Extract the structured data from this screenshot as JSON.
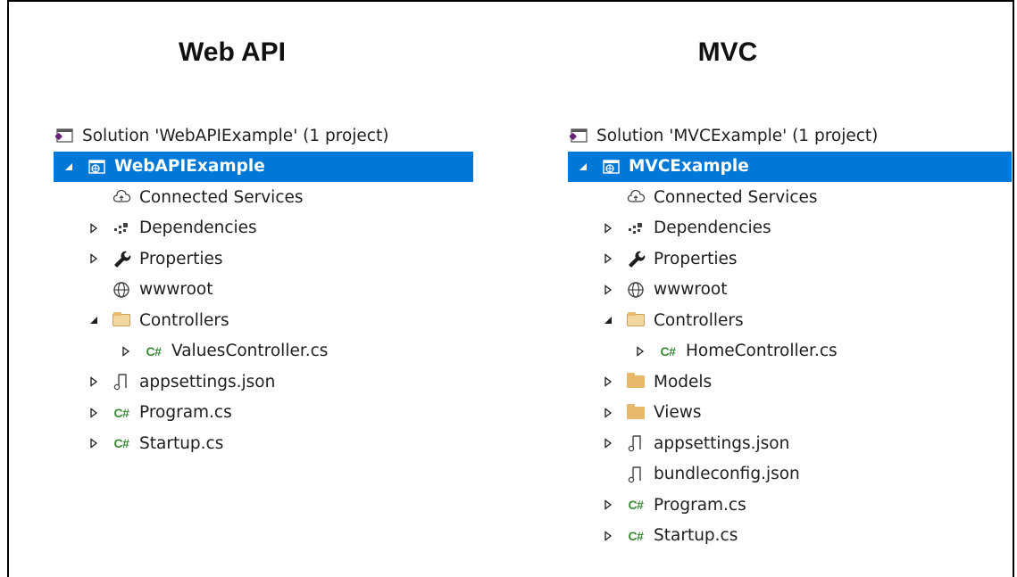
{
  "left": {
    "heading": "Web API",
    "solution": "Solution 'WebAPIExample' (1 project)",
    "project": "WebAPIExample",
    "items": [
      {
        "label": "Connected Services",
        "icon": "connected-services-icon",
        "arrow": "none",
        "level": 1
      },
      {
        "label": "Dependencies",
        "icon": "dependencies-icon",
        "arrow": "collapsed",
        "level": 1
      },
      {
        "label": "Properties",
        "icon": "wrench-icon",
        "arrow": "collapsed",
        "level": 1
      },
      {
        "label": "wwwroot",
        "icon": "globe-icon",
        "arrow": "none",
        "level": 1
      },
      {
        "label": "Controllers",
        "icon": "folder-open-icon",
        "arrow": "expanded",
        "level": 1
      },
      {
        "label": "ValuesController.cs",
        "icon": "csharp-file-icon",
        "arrow": "collapsed",
        "level": 2
      },
      {
        "label": "appsettings.json",
        "icon": "json-file-icon",
        "arrow": "collapsed",
        "level": 1
      },
      {
        "label": "Program.cs",
        "icon": "csharp-file-icon",
        "arrow": "collapsed",
        "level": 1
      },
      {
        "label": "Startup.cs",
        "icon": "csharp-file-icon",
        "arrow": "collapsed",
        "level": 1
      }
    ]
  },
  "right": {
    "heading": "MVC",
    "solution": "Solution 'MVCExample' (1 project)",
    "project": "MVCExample",
    "items": [
      {
        "label": "Connected Services",
        "icon": "connected-services-icon",
        "arrow": "none",
        "level": 1
      },
      {
        "label": "Dependencies",
        "icon": "dependencies-icon",
        "arrow": "collapsed",
        "level": 1
      },
      {
        "label": "Properties",
        "icon": "wrench-icon",
        "arrow": "collapsed",
        "level": 1
      },
      {
        "label": "wwwroot",
        "icon": "globe-icon",
        "arrow": "collapsed",
        "level": 1
      },
      {
        "label": "Controllers",
        "icon": "folder-open-icon",
        "arrow": "expanded",
        "level": 1
      },
      {
        "label": "HomeController.cs",
        "icon": "csharp-file-icon",
        "arrow": "collapsed",
        "level": 2
      },
      {
        "label": "Models",
        "icon": "folder-icon",
        "arrow": "collapsed",
        "level": 1
      },
      {
        "label": "Views",
        "icon": "folder-icon",
        "arrow": "collapsed",
        "level": 1
      },
      {
        "label": "appsettings.json",
        "icon": "json-file-icon",
        "arrow": "collapsed",
        "level": 1
      },
      {
        "label": "bundleconfig.json",
        "icon": "json-file-icon",
        "arrow": "none",
        "level": 1
      },
      {
        "label": "Program.cs",
        "icon": "csharp-file-icon",
        "arrow": "collapsed",
        "level": 1
      },
      {
        "label": "Startup.cs",
        "icon": "csharp-file-icon",
        "arrow": "collapsed",
        "level": 1
      }
    ]
  },
  "colors": {
    "selection": "#0078d7",
    "csharp": "#388a34",
    "folder": "#e8b96a"
  }
}
